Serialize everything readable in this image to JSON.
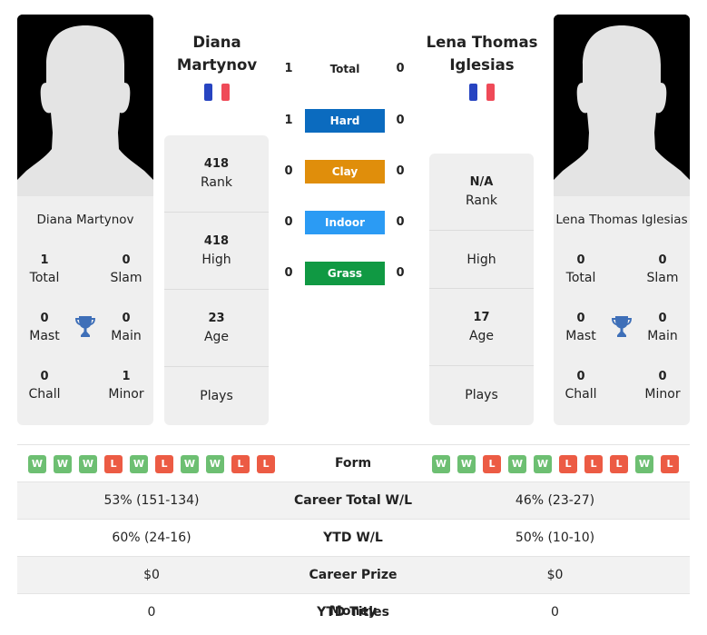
{
  "colors": {
    "hard": "#0b6bbf",
    "clay": "#e08e0b",
    "indoor": "#2b9bf4",
    "grass": "#109943",
    "win": "#6dbf72",
    "loss": "#ec5b44",
    "trophy": "#3e6fb8"
  },
  "player1": {
    "name": "Diana Martynov",
    "flag": "france-flag",
    "titles": {
      "total": {
        "value": "1",
        "label": "Total"
      },
      "slam": {
        "value": "0",
        "label": "Slam"
      },
      "mast": {
        "value": "0",
        "label": "Mast"
      },
      "main": {
        "value": "0",
        "label": "Main"
      },
      "chall": {
        "value": "0",
        "label": "Chall"
      },
      "minor": {
        "value": "1",
        "label": "Minor"
      }
    },
    "info": {
      "rank": {
        "value": "418",
        "label": "Rank"
      },
      "high": {
        "value": "418",
        "label": "High"
      },
      "age": {
        "value": "23",
        "label": "Age"
      },
      "plays": {
        "value": "",
        "label": "Plays"
      }
    },
    "form": [
      "W",
      "W",
      "W",
      "L",
      "W",
      "L",
      "W",
      "W",
      "L",
      "L"
    ]
  },
  "player2": {
    "name": "Lena Thomas Iglesias",
    "flag": "france-flag",
    "titles": {
      "total": {
        "value": "0",
        "label": "Total"
      },
      "slam": {
        "value": "0",
        "label": "Slam"
      },
      "mast": {
        "value": "0",
        "label": "Mast"
      },
      "main": {
        "value": "0",
        "label": "Main"
      },
      "chall": {
        "value": "0",
        "label": "Chall"
      },
      "minor": {
        "value": "0",
        "label": "Minor"
      }
    },
    "info": {
      "rank": {
        "value": "N/A",
        "label": "Rank"
      },
      "high": {
        "value": "",
        "label": "High"
      },
      "age": {
        "value": "17",
        "label": "Age"
      },
      "plays": {
        "value": "",
        "label": "Plays"
      }
    },
    "form": [
      "W",
      "W",
      "L",
      "W",
      "W",
      "L",
      "L",
      "L",
      "W",
      "L"
    ]
  },
  "h2h": [
    {
      "label": "Total",
      "p1": "1",
      "p2": "0",
      "surface": "total"
    },
    {
      "label": "Hard",
      "p1": "1",
      "p2": "0",
      "surface": "hard"
    },
    {
      "label": "Clay",
      "p1": "0",
      "p2": "0",
      "surface": "clay"
    },
    {
      "label": "Indoor",
      "p1": "0",
      "p2": "0",
      "surface": "indoor"
    },
    {
      "label": "Grass",
      "p1": "0",
      "p2": "0",
      "surface": "grass"
    }
  ],
  "comparison": {
    "form_label": "Form",
    "rows": [
      {
        "label": "Career Total W/L",
        "p1": "53% (151-134)",
        "p2": "46% (23-27)"
      },
      {
        "label": "YTD W/L",
        "p1": "60% (24-16)",
        "p2": "50% (10-10)"
      },
      {
        "label": "Career Prize Money",
        "p1": "$0",
        "p2": "$0"
      },
      {
        "label": "YTD Titles",
        "p1": "0",
        "p2": "0"
      }
    ]
  }
}
